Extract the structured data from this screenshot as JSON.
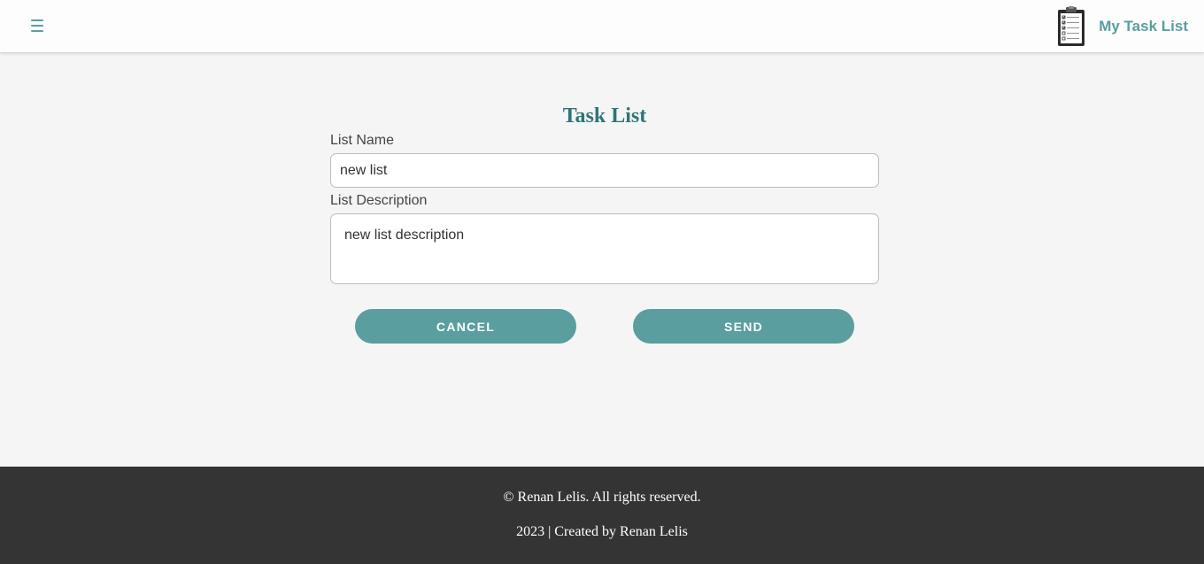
{
  "header": {
    "brand_title": "My Task List",
    "brand_logo_icon": "clipboard-checklist-icon",
    "menu_icon": "hamburger-menu-icon",
    "accent_color": "#5a9ea0"
  },
  "form": {
    "title": "Task List",
    "name_label": "List Name",
    "name_value": "new list",
    "description_label": "List Description",
    "description_value": "new list description",
    "cancel_label": "CANCEL",
    "send_label": "SEND"
  },
  "footer": {
    "copyright": "© Renan Lelis. All rights reserved.",
    "credit": "2023 | Created by Renan Lelis",
    "background_color": "#343434"
  }
}
